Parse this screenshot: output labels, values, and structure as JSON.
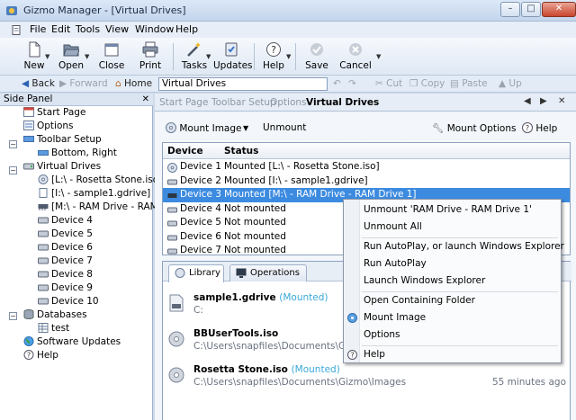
{
  "window": {
    "title": "Gizmo Manager - [Virtual Drives]",
    "btn_min": "–",
    "btn_max": "□",
    "btn_close": "✕"
  },
  "menu": [
    {
      "label": "File"
    },
    {
      "label": "Edit"
    },
    {
      "label": "Tools"
    },
    {
      "label": "View"
    },
    {
      "label": "Window"
    },
    {
      "label": "Help"
    }
  ],
  "toolbar": {
    "new": "New",
    "open": "Open",
    "close": "Close",
    "print": "Print",
    "tasks": "Tasks",
    "updates": "Updates",
    "help": "Help",
    "save": "Save",
    "cancel": "Cancel"
  },
  "nav": {
    "back": "Back",
    "forward": "Forward",
    "home": "Home",
    "address": "Virtual Drives",
    "cut": "Cut",
    "copy": "Copy",
    "paste": "Paste",
    "up": "Up"
  },
  "side_panel": {
    "title": "Side Panel",
    "close": "✕",
    "items": [
      {
        "label": "Start Page"
      },
      {
        "label": "Options"
      },
      {
        "label": "Toolbar Setup"
      },
      {
        "label": "Bottom, Right"
      },
      {
        "label": "Virtual Drives"
      },
      {
        "label": "[L:\\ - Rosetta Stone.iso]"
      },
      {
        "label": "[I:\\ - sample1.gdrive]"
      },
      {
        "label": "[M:\\ - RAM Drive - RAM D"
      },
      {
        "label": "Device 4"
      },
      {
        "label": "Device 5"
      },
      {
        "label": "Device 6"
      },
      {
        "label": "Device 7"
      },
      {
        "label": "Device 8"
      },
      {
        "label": "Device 9"
      },
      {
        "label": "Device 10"
      },
      {
        "label": "Databases"
      },
      {
        "label": "test"
      },
      {
        "label": "Software Updates"
      },
      {
        "label": "Help"
      }
    ]
  },
  "tabs": [
    {
      "label": "Start Page"
    },
    {
      "label": "Toolbar Setup"
    },
    {
      "label": "Options"
    },
    {
      "label": "Virtual Drives"
    }
  ],
  "tab_nav": {
    "prev": "◀",
    "next": "▶",
    "close": "✕"
  },
  "vd_toolbar": {
    "mount_image": "Mount Image",
    "unmount": "Unmount",
    "mount_options": "Mount Options",
    "help": "Help"
  },
  "grid": {
    "headers": [
      "Device",
      "Status"
    ],
    "rows": [
      {
        "device": "Device 1",
        "status": "Mounted [L:\\ - Rosetta Stone.iso]"
      },
      {
        "device": "Device 2",
        "status": "Mounted [I:\\ - sample1.gdrive]"
      },
      {
        "device": "Device 3",
        "status": "Mounted [M:\\ - RAM Drive - RAM Drive 1]"
      },
      {
        "device": "Device 4",
        "status": "Not mounted"
      },
      {
        "device": "Device 5",
        "status": "Not mounted"
      },
      {
        "device": "Device 6",
        "status": "Not mounted"
      },
      {
        "device": "Device 7",
        "status": "Not mounted"
      }
    ]
  },
  "lower_tabs": [
    {
      "label": "Library"
    },
    {
      "label": "Operations"
    }
  ],
  "library": [
    {
      "name": "sample1.gdrive",
      "status": "(Mounted)",
      "path": "C:",
      "time": ""
    },
    {
      "name": "BBUserTools.iso",
      "status": "",
      "path": "C:\\Users\\snapfiles\\Documents\\Gizmo",
      "time": ""
    },
    {
      "name": "Rosetta Stone.iso",
      "status": "(Mounted)",
      "path": "C:\\Users\\snapfiles\\Documents\\Gizmo\\Images",
      "time": "55 minutes ago"
    }
  ],
  "context_menu": [
    {
      "label": "Unmount 'RAM Drive - RAM Drive 1'"
    },
    {
      "label": "Unmount All"
    },
    {
      "label": "Run AutoPlay, or launch Windows Explorer"
    },
    {
      "label": "Run AutoPlay"
    },
    {
      "label": "Launch Windows Explorer"
    },
    {
      "label": "Open Containing Folder"
    },
    {
      "label": "Mount Image"
    },
    {
      "label": "Options"
    },
    {
      "label": "Help"
    }
  ],
  "colors": {
    "selection": "#3c8be0",
    "mounted": "#38a8d8",
    "close_button": "#c9452d"
  }
}
